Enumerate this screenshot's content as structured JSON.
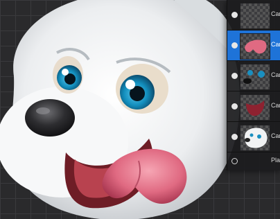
{
  "layers": [
    {
      "label": "Can",
      "visible": true,
      "selected": false,
      "thumb": "blank-layer"
    },
    {
      "label": "Can",
      "visible": true,
      "selected": true,
      "thumb": "tongue"
    },
    {
      "label": "Can",
      "visible": true,
      "selected": false,
      "thumb": "eyes-nose"
    },
    {
      "label": "Can",
      "visible": true,
      "selected": false,
      "thumb": "mouth"
    },
    {
      "label": "Can",
      "visible": true,
      "selected": false,
      "thumb": "dog-face"
    },
    {
      "label": "Plai",
      "visible": false,
      "selected": false,
      "thumb": "plain"
    }
  ],
  "colors": {
    "selection": "#1e73d8",
    "panel": "#1c1c1e",
    "canvas_grid": "#3a3a3d"
  }
}
